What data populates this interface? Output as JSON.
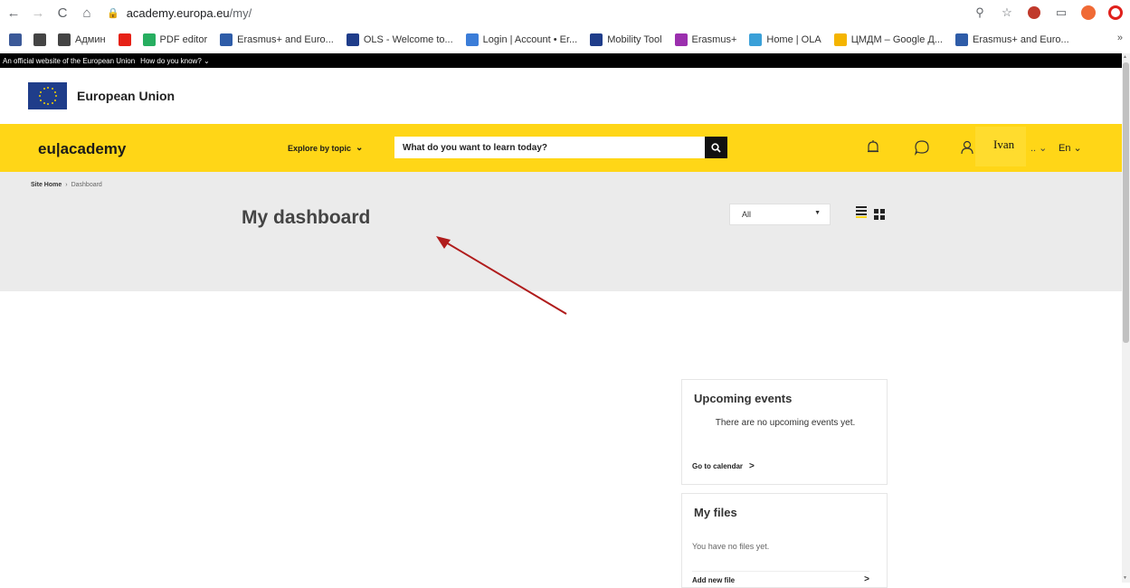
{
  "browser": {
    "url_host": "academy.europa.eu",
    "url_path": "/my/",
    "bookmarks": [
      {
        "label": "",
        "color": "#3b5998"
      },
      {
        "label": "",
        "color": "#444444"
      },
      {
        "label": "Админ",
        "color": "#444444"
      },
      {
        "label": "",
        "color": "#e62117"
      },
      {
        "label": "PDF editor",
        "color": "#27ae60"
      },
      {
        "label": "Erasmus+ and Euro...",
        "color": "#2e5ca8"
      },
      {
        "label": "OLS - Welcome to...",
        "color": "#1f3d8a"
      },
      {
        "label": "Login | Account • Er...",
        "color": "#3b7dd8"
      },
      {
        "label": "Mobility Tool",
        "color": "#1f3d8a"
      },
      {
        "label": "Erasmus+",
        "color": "#9b2fae"
      },
      {
        "label": "Home | OLA",
        "color": "#3aa0d8"
      },
      {
        "label": "ЦМДМ – Google Д...",
        "color": "#f4b400"
      },
      {
        "label": "Erasmus+ and Euro...",
        "color": "#2e5ca8"
      }
    ],
    "more": "»"
  },
  "eu": {
    "official_text": "An official website of the European Union",
    "how_text": "How do you know?",
    "title": "European Union"
  },
  "header": {
    "brand": "eu|academy",
    "explore": "Explore by topic",
    "search_placeholder": "What do you want to learn today?",
    "user_name": "Ivan",
    "lang": "En",
    "accent_color": "#ffd617"
  },
  "dashboard": {
    "breadcrumb_home": "Site Home",
    "breadcrumb_current": "Dashboard",
    "title": "My dashboard",
    "filter_value": "All"
  },
  "events_card": {
    "title": "Upcoming events",
    "empty": "There are no upcoming events yet.",
    "link": "Go to calendar"
  },
  "files_card": {
    "title": "My files",
    "empty": "You have no files yet.",
    "link": "Add new file"
  }
}
